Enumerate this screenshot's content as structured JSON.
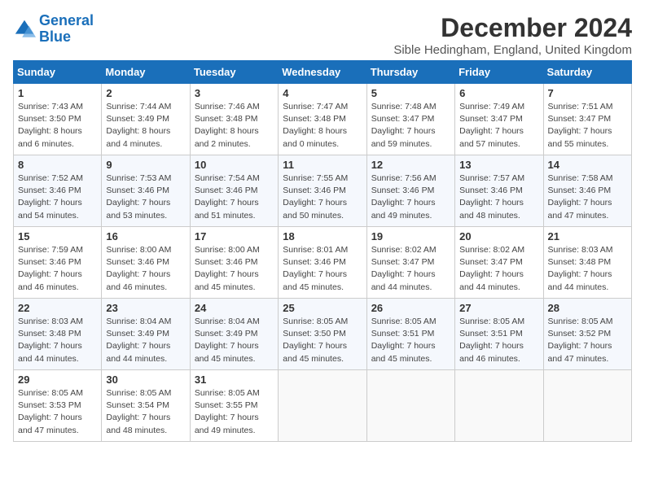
{
  "logo": {
    "line1": "General",
    "line2": "Blue"
  },
  "title": "December 2024",
  "subtitle": "Sible Hedingham, England, United Kingdom",
  "days_of_week": [
    "Sunday",
    "Monday",
    "Tuesday",
    "Wednesday",
    "Thursday",
    "Friday",
    "Saturday"
  ],
  "weeks": [
    [
      {
        "day": "1",
        "info": "Sunrise: 7:43 AM\nSunset: 3:50 PM\nDaylight: 8 hours\nand 6 minutes."
      },
      {
        "day": "2",
        "info": "Sunrise: 7:44 AM\nSunset: 3:49 PM\nDaylight: 8 hours\nand 4 minutes."
      },
      {
        "day": "3",
        "info": "Sunrise: 7:46 AM\nSunset: 3:48 PM\nDaylight: 8 hours\nand 2 minutes."
      },
      {
        "day": "4",
        "info": "Sunrise: 7:47 AM\nSunset: 3:48 PM\nDaylight: 8 hours\nand 0 minutes."
      },
      {
        "day": "5",
        "info": "Sunrise: 7:48 AM\nSunset: 3:47 PM\nDaylight: 7 hours\nand 59 minutes."
      },
      {
        "day": "6",
        "info": "Sunrise: 7:49 AM\nSunset: 3:47 PM\nDaylight: 7 hours\nand 57 minutes."
      },
      {
        "day": "7",
        "info": "Sunrise: 7:51 AM\nSunset: 3:47 PM\nDaylight: 7 hours\nand 55 minutes."
      }
    ],
    [
      {
        "day": "8",
        "info": "Sunrise: 7:52 AM\nSunset: 3:46 PM\nDaylight: 7 hours\nand 54 minutes."
      },
      {
        "day": "9",
        "info": "Sunrise: 7:53 AM\nSunset: 3:46 PM\nDaylight: 7 hours\nand 53 minutes."
      },
      {
        "day": "10",
        "info": "Sunrise: 7:54 AM\nSunset: 3:46 PM\nDaylight: 7 hours\nand 51 minutes."
      },
      {
        "day": "11",
        "info": "Sunrise: 7:55 AM\nSunset: 3:46 PM\nDaylight: 7 hours\nand 50 minutes."
      },
      {
        "day": "12",
        "info": "Sunrise: 7:56 AM\nSunset: 3:46 PM\nDaylight: 7 hours\nand 49 minutes."
      },
      {
        "day": "13",
        "info": "Sunrise: 7:57 AM\nSunset: 3:46 PM\nDaylight: 7 hours\nand 48 minutes."
      },
      {
        "day": "14",
        "info": "Sunrise: 7:58 AM\nSunset: 3:46 PM\nDaylight: 7 hours\nand 47 minutes."
      }
    ],
    [
      {
        "day": "15",
        "info": "Sunrise: 7:59 AM\nSunset: 3:46 PM\nDaylight: 7 hours\nand 46 minutes."
      },
      {
        "day": "16",
        "info": "Sunrise: 8:00 AM\nSunset: 3:46 PM\nDaylight: 7 hours\nand 46 minutes."
      },
      {
        "day": "17",
        "info": "Sunrise: 8:00 AM\nSunset: 3:46 PM\nDaylight: 7 hours\nand 45 minutes."
      },
      {
        "day": "18",
        "info": "Sunrise: 8:01 AM\nSunset: 3:46 PM\nDaylight: 7 hours\nand 45 minutes."
      },
      {
        "day": "19",
        "info": "Sunrise: 8:02 AM\nSunset: 3:47 PM\nDaylight: 7 hours\nand 44 minutes."
      },
      {
        "day": "20",
        "info": "Sunrise: 8:02 AM\nSunset: 3:47 PM\nDaylight: 7 hours\nand 44 minutes."
      },
      {
        "day": "21",
        "info": "Sunrise: 8:03 AM\nSunset: 3:48 PM\nDaylight: 7 hours\nand 44 minutes."
      }
    ],
    [
      {
        "day": "22",
        "info": "Sunrise: 8:03 AM\nSunset: 3:48 PM\nDaylight: 7 hours\nand 44 minutes."
      },
      {
        "day": "23",
        "info": "Sunrise: 8:04 AM\nSunset: 3:49 PM\nDaylight: 7 hours\nand 44 minutes."
      },
      {
        "day": "24",
        "info": "Sunrise: 8:04 AM\nSunset: 3:49 PM\nDaylight: 7 hours\nand 45 minutes."
      },
      {
        "day": "25",
        "info": "Sunrise: 8:05 AM\nSunset: 3:50 PM\nDaylight: 7 hours\nand 45 minutes."
      },
      {
        "day": "26",
        "info": "Sunrise: 8:05 AM\nSunset: 3:51 PM\nDaylight: 7 hours\nand 45 minutes."
      },
      {
        "day": "27",
        "info": "Sunrise: 8:05 AM\nSunset: 3:51 PM\nDaylight: 7 hours\nand 46 minutes."
      },
      {
        "day": "28",
        "info": "Sunrise: 8:05 AM\nSunset: 3:52 PM\nDaylight: 7 hours\nand 47 minutes."
      }
    ],
    [
      {
        "day": "29",
        "info": "Sunrise: 8:05 AM\nSunset: 3:53 PM\nDaylight: 7 hours\nand 47 minutes."
      },
      {
        "day": "30",
        "info": "Sunrise: 8:05 AM\nSunset: 3:54 PM\nDaylight: 7 hours\nand 48 minutes."
      },
      {
        "day": "31",
        "info": "Sunrise: 8:05 AM\nSunset: 3:55 PM\nDaylight: 7 hours\nand 49 minutes."
      },
      {
        "day": "",
        "info": ""
      },
      {
        "day": "",
        "info": ""
      },
      {
        "day": "",
        "info": ""
      },
      {
        "day": "",
        "info": ""
      }
    ]
  ]
}
